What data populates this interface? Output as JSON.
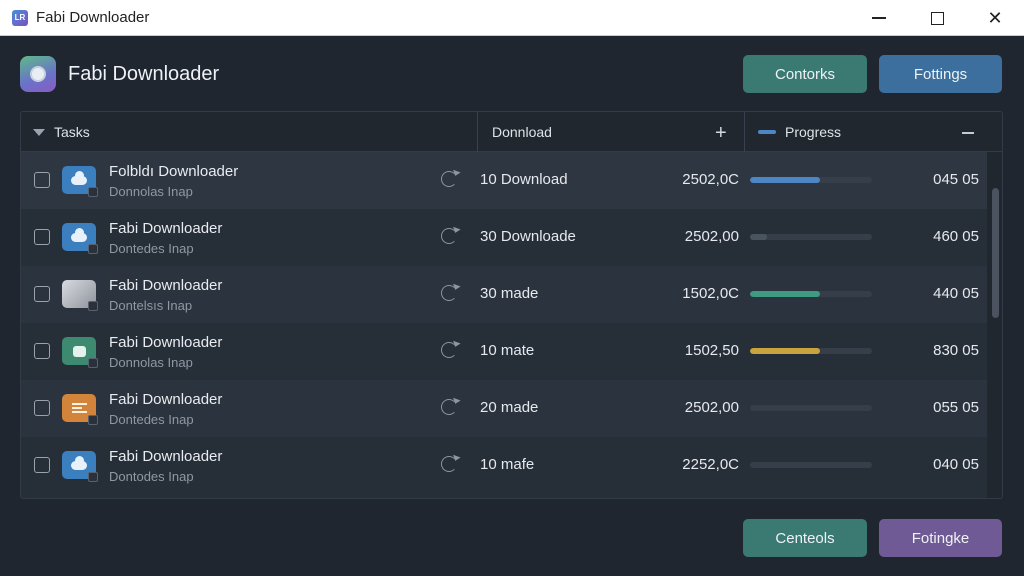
{
  "window": {
    "title": "Fabi Downloader",
    "logo_text": "LR"
  },
  "header": {
    "title": "Fabi Downloader"
  },
  "top_buttons": {
    "contorks": "Contorks",
    "fottings": "Fottings"
  },
  "bottom_buttons": {
    "centeols": "Centeols",
    "fotingke": "Fotingke"
  },
  "columns": {
    "tasks": "Tasks",
    "download": "Donnload",
    "progress": "Progress"
  },
  "colors": {
    "teal": "#3a7a73",
    "blue": "#3c6f9e",
    "purple": "#6f5a96",
    "bar_blue": "#4d86c4",
    "bar_green": "#3f9a82",
    "bar_yellow": "#c9a43e",
    "bar_gray": "#4a545f"
  },
  "rows": [
    {
      "name": "Folbldı Downloader",
      "sub": "Donnolas Inap",
      "icon": "cloud-icon",
      "downloads": "10 Download",
      "size": "2502,0C",
      "progress": 0.57,
      "bar_color": "#4d86c4",
      "value": "045 05"
    },
    {
      "name": "Fabi Downloader",
      "sub": "Dontedes Inap",
      "icon": "cloud-icon",
      "downloads": "30 Downloade",
      "size": "2502,00",
      "progress": 0.14,
      "bar_color": "#4a545f",
      "value": "460 05"
    },
    {
      "name": "Fabi Downloader",
      "sub": "Dontelsıs Inap",
      "icon": "image-icon",
      "downloads": "30 made",
      "size": "1502,0C",
      "progress": 0.57,
      "bar_color": "#3f9a82",
      "value": "440 05"
    },
    {
      "name": "Fabi Downloader",
      "sub": "Donnolas Inap",
      "icon": "chat-icon",
      "downloads": "10 mate",
      "size": "1502,50",
      "progress": 0.57,
      "bar_color": "#c9a43e",
      "value": "830 05"
    },
    {
      "name": "Fabi Downloader",
      "sub": "Dontedes Inap",
      "icon": "document-icon",
      "downloads": "20 made",
      "size": "2502,00",
      "progress": 0.0,
      "bar_color": "#4a545f",
      "value": "055 05"
    },
    {
      "name": "Fabi Downloader",
      "sub": "Dontodes Inap",
      "icon": "cloud-icon",
      "downloads": "10 mafe",
      "size": "2252,0C",
      "progress": 0.0,
      "bar_color": "#4a545f",
      "value": "040 05"
    }
  ]
}
